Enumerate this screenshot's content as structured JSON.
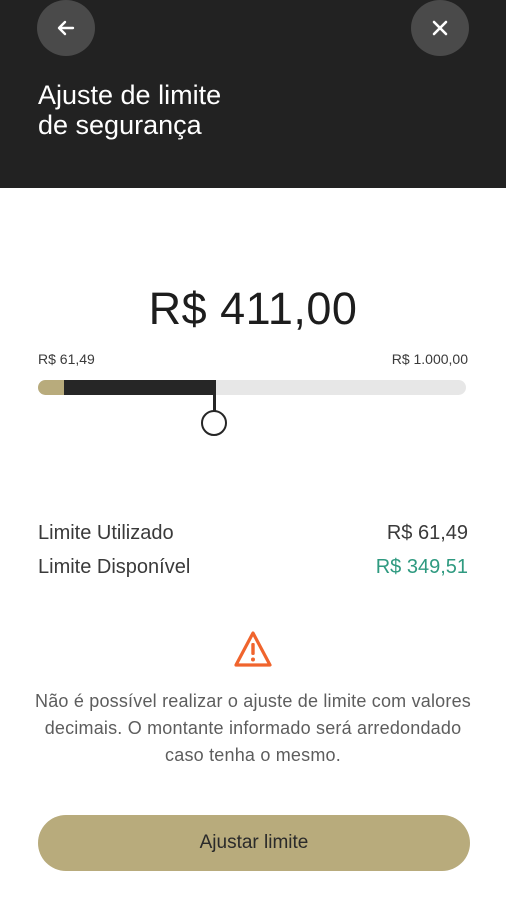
{
  "header": {
    "title_line1": "Ajuste de limite",
    "title_line2": "de segurança",
    "back_icon": "arrow-left-icon",
    "close_icon": "close-icon"
  },
  "slider": {
    "current_value": "R$ 411,00",
    "min_label": "R$ 61,49",
    "max_label": "R$ 1.000,00",
    "min_value": 61.49,
    "max_value": 1000.0,
    "value": 411.0
  },
  "limits": {
    "used_label": "Limite Utilizado",
    "used_value": "R$ 61,49",
    "available_label": "Limite Disponível",
    "available_value": "R$ 349,51"
  },
  "warning": {
    "icon": "warning-triangle-icon",
    "text": "Não é possível realizar o ajuste de limite com valores decimais. O montante informado será arredondado caso tenha o mesmo."
  },
  "actions": {
    "adjust_label": "Ajustar limite"
  },
  "colors": {
    "header_bg": "#222222",
    "accent_gold": "#b8ab7c",
    "available_green": "#2f9a80",
    "warning_orange": "#f0642d"
  }
}
